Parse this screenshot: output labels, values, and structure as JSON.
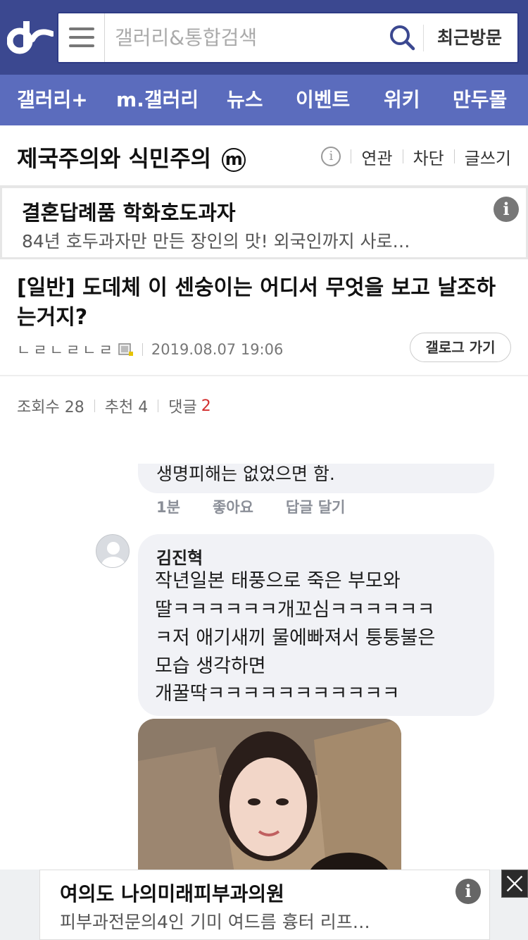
{
  "header": {
    "search_placeholder": "갤러리&통합검색",
    "recent_label": "최근방문",
    "brand_color": "#3b4890",
    "nav_color": "#5b6cbd"
  },
  "nav": {
    "items": [
      {
        "label": "갤러리+"
      },
      {
        "label": "m.갤러리"
      },
      {
        "label": "뉴스"
      },
      {
        "label": "이벤트"
      },
      {
        "label": "위키"
      },
      {
        "label": "만두몰"
      }
    ]
  },
  "gallery": {
    "title": "제국주의와 식민주의",
    "badge": "m",
    "info_icon": "info-icon",
    "actions": [
      "연관",
      "차단",
      "글쓰기"
    ]
  },
  "ad": {
    "title": "결혼답례품 학화호도과자",
    "subtitle": "84년 호두과자만 만든 장인의 맛! 외국인까지 사로…",
    "info": "i"
  },
  "post": {
    "title": "[일반] 도데체 이 센숭이는 어디서 무엇을 보고 날조하는거지?",
    "author": "ㄴㄹㄴㄹㄴㄹ",
    "date": "2019.08.07 19:06",
    "gallog_label": "갤로그 가기",
    "views_label": "조회수 28",
    "recommend_label": "추천 4",
    "comments_label": "댓글",
    "comments_count": "2"
  },
  "embedded": {
    "prev_text": "생명피해는 없었으면 함.",
    "actions": [
      "1분",
      "좋아요",
      "답글 달기"
    ],
    "author": "김진혁",
    "lines": [
      "작년일본 태풍으로 죽은 부모와",
      "딸ㅋㅋㅋㅋㅋㅋ개꼬심ㅋㅋㅋㅋㅋㅋ",
      "ㅋ저 애기새끼 물에빠져서 퉁퉁불은",
      "모습 생각하면",
      "개꿀딱ㅋㅋㅋㅋㅋㅋㅋㅋㅋㅋㅋ"
    ]
  },
  "bottom_ad": {
    "title": "여의도 나의미래피부과의원",
    "subtitle": "피부과전문의4인 기미 여드름 흉터 리프…",
    "info": "i",
    "close_icon": "close-icon"
  }
}
